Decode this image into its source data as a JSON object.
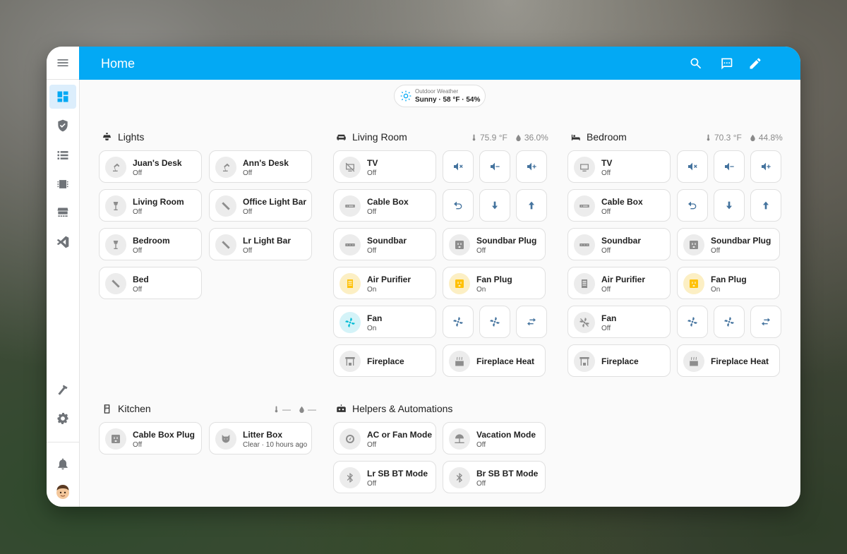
{
  "header": {
    "title": "Home"
  },
  "weather": {
    "label": "Outdoor Weather",
    "value": "Sunny · 58 °F · 54%"
  },
  "sections": {
    "lights": {
      "title": "Lights",
      "tiles": [
        {
          "name": "Juan's Desk",
          "state": "Off"
        },
        {
          "name": "Ann's Desk",
          "state": "Off"
        },
        {
          "name": "Living Room",
          "state": "Off"
        },
        {
          "name": "Office Light Bar",
          "state": "Off"
        },
        {
          "name": "Bedroom",
          "state": "Off"
        },
        {
          "name": "Lr Light Bar",
          "state": "Off"
        },
        {
          "name": "Bed",
          "state": "Off"
        }
      ]
    },
    "living_room": {
      "title": "Living Room",
      "temperature": "75.9 °F",
      "humidity": "36.0%",
      "tiles": [
        {
          "name": "TV",
          "state": "Off"
        },
        {
          "name": "Cable Box",
          "state": "Off"
        },
        {
          "name": "Soundbar",
          "state": "Off"
        },
        {
          "name": "Soundbar Plug",
          "state": "Off"
        },
        {
          "name": "Air Purifier",
          "state": "On"
        },
        {
          "name": "Fan Plug",
          "state": "On"
        },
        {
          "name": "Fan",
          "state": "On"
        },
        {
          "name": "Fireplace",
          "state": ""
        },
        {
          "name": "Fireplace Heat",
          "state": ""
        }
      ]
    },
    "bedroom": {
      "title": "Bedroom",
      "temperature": "70.3 °F",
      "humidity": "44.8%",
      "tiles": [
        {
          "name": "TV",
          "state": "Off"
        },
        {
          "name": "Cable Box",
          "state": "Off"
        },
        {
          "name": "Soundbar",
          "state": "Off"
        },
        {
          "name": "Soundbar Plug",
          "state": "Off"
        },
        {
          "name": "Air Purifier",
          "state": "Off"
        },
        {
          "name": "Fan Plug",
          "state": "On"
        },
        {
          "name": "Fan",
          "state": "Off"
        },
        {
          "name": "Fireplace",
          "state": ""
        },
        {
          "name": "Fireplace Heat",
          "state": ""
        }
      ]
    },
    "kitchen": {
      "title": "Kitchen",
      "temperature": "—",
      "humidity": "—",
      "tiles": [
        {
          "name": "Cable Box Plug",
          "state": "Off"
        },
        {
          "name": "Litter Box",
          "state": "Clear · 10 hours ago"
        }
      ]
    },
    "helpers": {
      "title": "Helpers & Automations",
      "tiles": [
        {
          "name": "AC or Fan Mode",
          "state": "Off"
        },
        {
          "name": "Vacation Mode",
          "state": "Off"
        },
        {
          "name": "Lr SB BT Mode",
          "state": "Off"
        },
        {
          "name": "Br SB BT Mode",
          "state": "Off"
        }
      ]
    }
  },
  "icons": {
    "sidebar": [
      "menu-icon",
      "dashboard-icon",
      "shield-icon",
      "list-icon",
      "chip-icon",
      "hacs-store-icon",
      "vscode-icon",
      "hammer-icon",
      "gear-icon",
      "bell-icon",
      "avatar"
    ],
    "topbar": [
      "search-icon",
      "assist-icon",
      "pencil-icon"
    ]
  },
  "colors": {
    "accent": "#03a9f4",
    "on_state": "#ffc107",
    "fan_on": "#00bcd4",
    "button_icon": "#44739e"
  }
}
